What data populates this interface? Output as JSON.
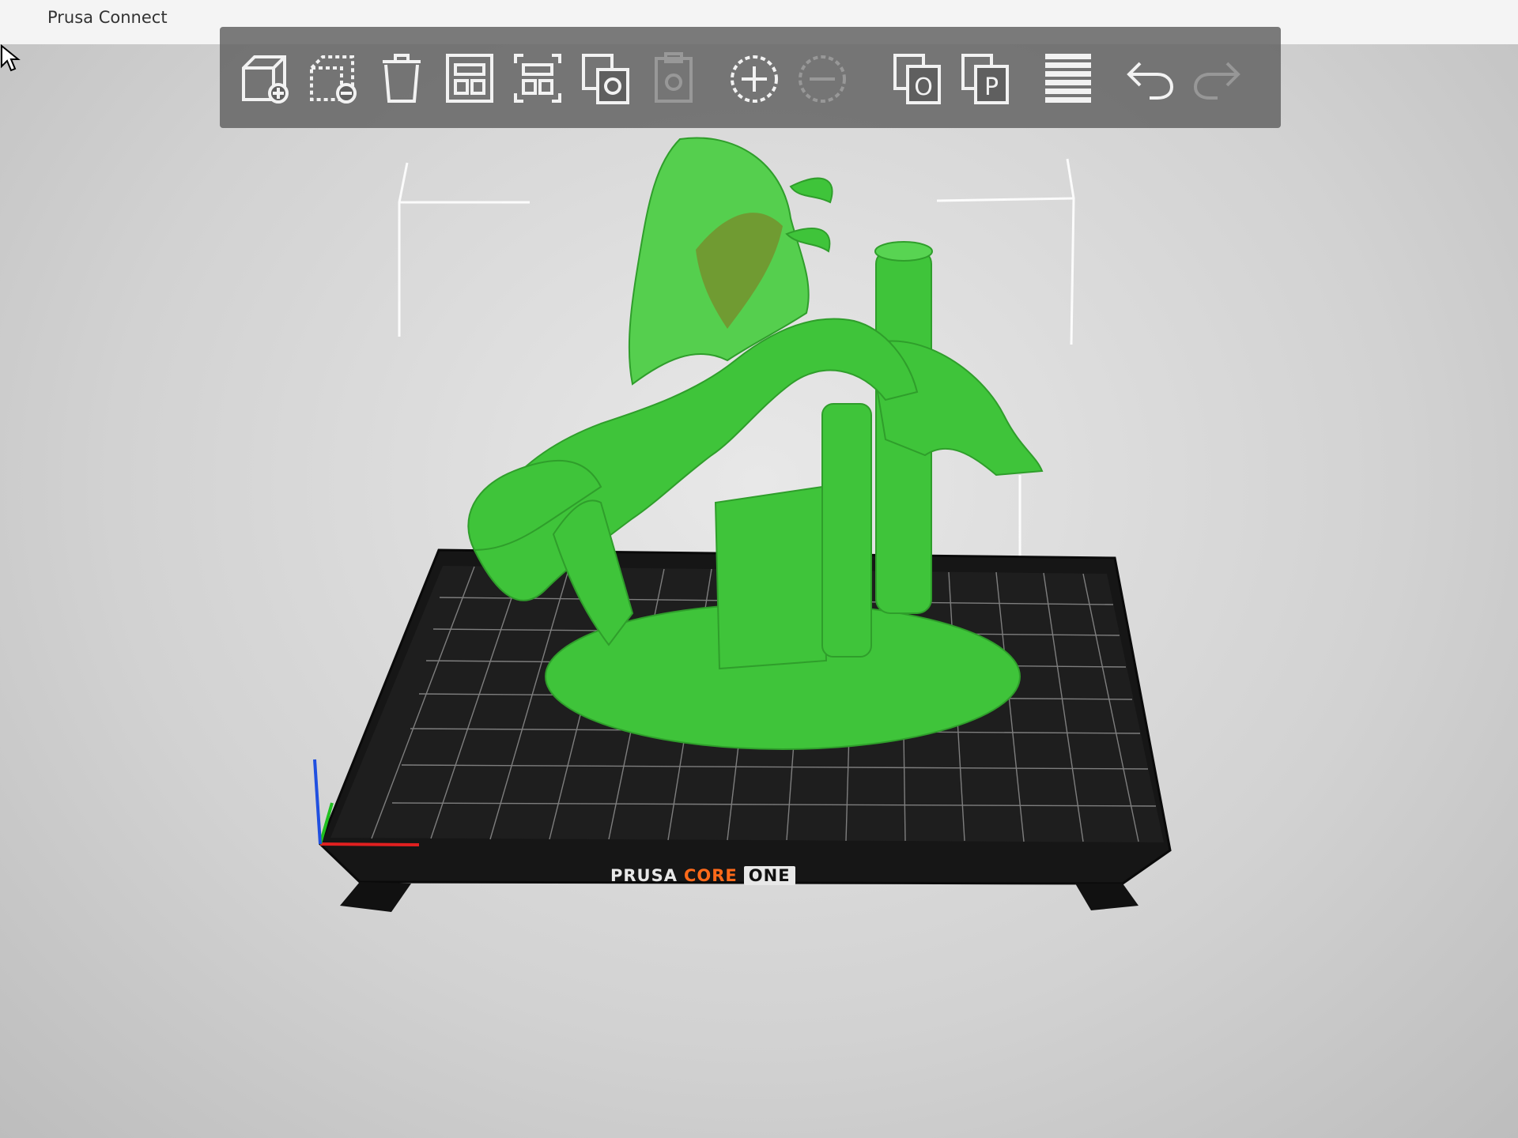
{
  "window": {
    "title": "Prusa Connect"
  },
  "toolbar": {
    "tools": [
      {
        "name": "add-object-button",
        "icon": "cube-plus-icon",
        "enabled": true
      },
      {
        "name": "remove-object-button",
        "icon": "cube-minus-icon",
        "enabled": true
      },
      {
        "name": "delete-button",
        "icon": "trash-icon",
        "enabled": true
      },
      {
        "name": "arrange-button",
        "icon": "arrange-icon",
        "enabled": true
      },
      {
        "name": "arrange-selection-button",
        "icon": "arrange-selection-icon",
        "enabled": true
      },
      {
        "name": "copy-button",
        "icon": "copy-icon",
        "enabled": true
      },
      {
        "name": "paste-button",
        "icon": "paste-icon",
        "enabled": false
      },
      {
        "name": "add-instance-button",
        "icon": "plus-circle-icon",
        "enabled": true
      },
      {
        "name": "remove-instance-button",
        "icon": "minus-circle-icon",
        "enabled": false
      },
      {
        "name": "split-to-objects-button",
        "icon": "split-objects-icon",
        "letter": "O",
        "enabled": true
      },
      {
        "name": "split-to-parts-button",
        "icon": "split-parts-icon",
        "letter": "P",
        "enabled": true
      },
      {
        "name": "layers-button",
        "icon": "layers-icon",
        "enabled": true
      },
      {
        "name": "undo-button",
        "icon": "undo-arrow-icon",
        "enabled": true
      },
      {
        "name": "redo-button",
        "icon": "redo-arrow-icon",
        "enabled": false
      }
    ]
  },
  "bed": {
    "brand_part1": "PRUSA",
    "brand_part2": "CORE",
    "brand_part3": "ONE",
    "colors": {
      "plate": "#141414",
      "grid": "#9a9a9a",
      "accent": "#ff6a1a"
    }
  },
  "model": {
    "color": "#3fc43a"
  },
  "axes": {
    "x_color": "#e02020",
    "y_color": "#20c020",
    "z_color": "#2050e0"
  }
}
